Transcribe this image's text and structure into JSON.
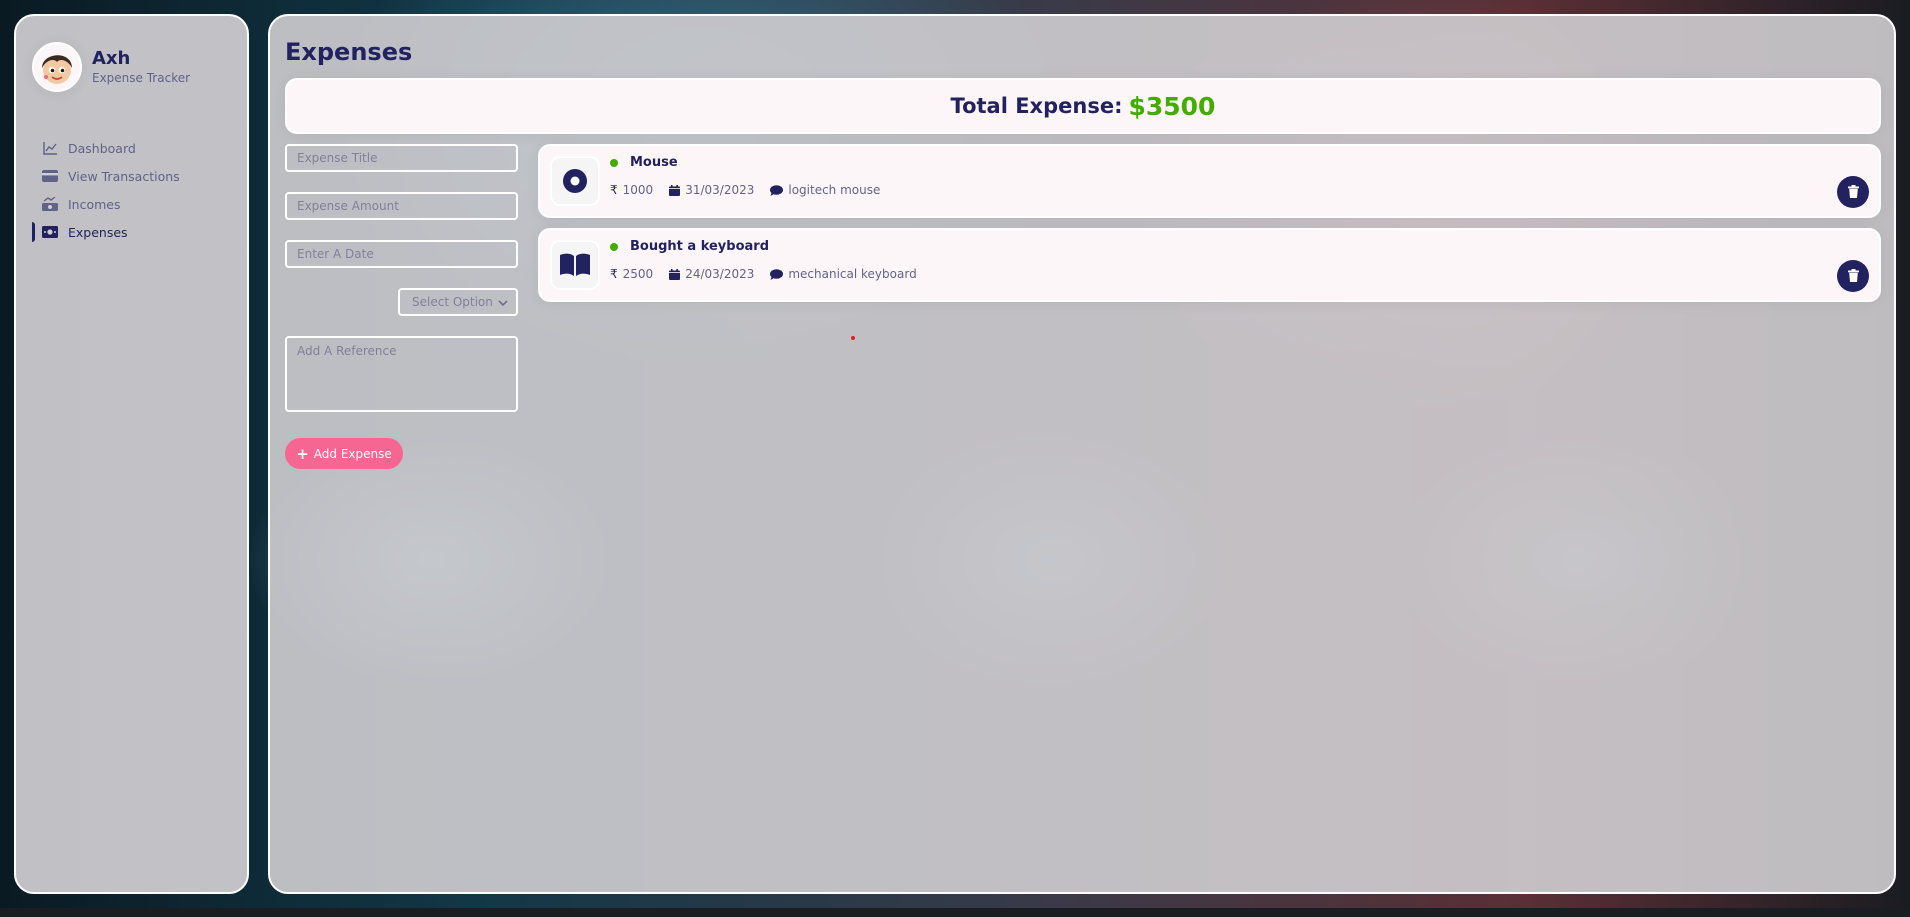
{
  "profile": {
    "name": "Axh",
    "subtitle": "Expense Tracker"
  },
  "nav": {
    "items": [
      {
        "label": "Dashboard",
        "icon": "chart-line-icon"
      },
      {
        "label": "View Transactions",
        "icon": "credit-card-icon"
      },
      {
        "label": "Incomes",
        "icon": "money-bill-trend-up-icon"
      },
      {
        "label": "Expenses",
        "icon": "money-bill-icon"
      }
    ],
    "active": "Expenses"
  },
  "page": {
    "title": "Expenses",
    "total_label": "Total Expense:",
    "total_value": "$3500"
  },
  "form": {
    "title_placeholder": "Expense Title",
    "amount_placeholder": "Expense Amount",
    "date_placeholder": "Enter A Date",
    "select_placeholder": "Select Option",
    "reference_placeholder": "Add A Reference",
    "add_button_label": "Add Expense"
  },
  "expenses": [
    {
      "title": "Mouse",
      "amount": "1000",
      "date": "31/03/2023",
      "description": "logitech mouse",
      "icon": "circle-dot-icon"
    },
    {
      "title": "Bought a keyboard",
      "amount": "2500",
      "date": "24/03/2023",
      "description": "mechanical keyboard",
      "icon": "book-open-icon"
    }
  ],
  "colors": {
    "primary": "#222260",
    "accent_green": "#42ad00",
    "button_pink": "#f56692",
    "card_bg": "#fcf6f9"
  },
  "currency_symbol": "₹"
}
